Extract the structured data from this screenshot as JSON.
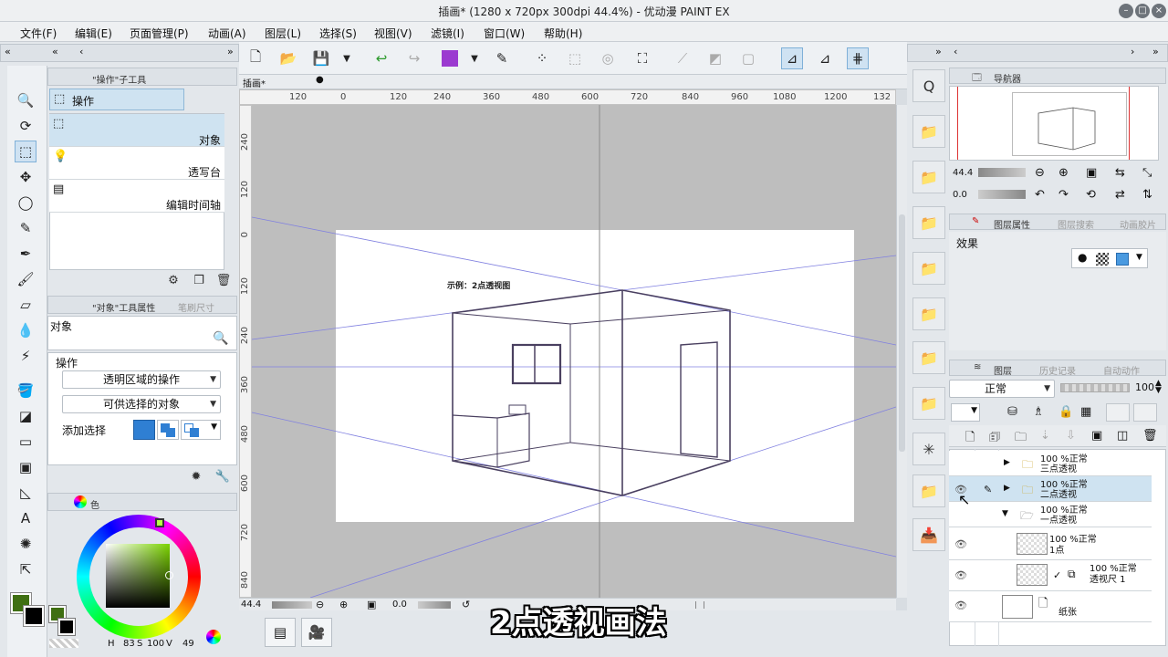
{
  "window": {
    "title": "插画* (1280 x 720px 300dpi 44.4%)  - 优动漫 PAINT EX",
    "minimize": "–",
    "restore": "□",
    "close": "×"
  },
  "menu": [
    "文件(F)",
    "编辑(E)",
    "页面管理(P)",
    "动画(A)",
    "图层(L)",
    "选择(S)",
    "视图(V)",
    "滤镜(I)",
    "窗口(W)",
    "帮助(H)"
  ],
  "tool_panel": {
    "tab": "\"操作\"子工具",
    "group_label": "操作",
    "subtools": [
      {
        "label": "对象",
        "icon": "object-select-icon"
      },
      {
        "label": "透写台",
        "icon": "light-table-icon"
      },
      {
        "label": "编辑时间轴",
        "icon": "timeline-icon"
      }
    ]
  },
  "property_panel": {
    "tab": "\"对象\"工具属性",
    "tab2": "笔刷尺寸",
    "title": "对象",
    "section": "操作",
    "dropdown1": "透明区域的操作",
    "dropdown2": "可供选择的对象",
    "add_select_label": "添加选择"
  },
  "color_panel": {
    "tab": "色",
    "h": "83",
    "s": "100",
    "v": "49",
    "h_label": "H",
    "s_label": "S",
    "v_label": "V"
  },
  "canvas": {
    "tab": "插画*",
    "ruler_h": [
      "120",
      "0",
      "120",
      "240",
      "360",
      "480",
      "600",
      "720",
      "840",
      "960",
      "1080",
      "1200",
      "132"
    ],
    "ruler_v": [
      "240",
      "120",
      "0",
      "120",
      "240",
      "360",
      "480",
      "600",
      "720",
      "840"
    ],
    "drawing_label": "示例：2点透视图",
    "zoom": "44.4",
    "rotate": "0.0"
  },
  "navigator": {
    "tab": "导航器",
    "zoom": "44.4",
    "rotate": "0.0"
  },
  "layer_property": {
    "tab": "图层属性",
    "tab2": "图层搜索",
    "tab3": "动画胶片",
    "effect_label": "效果"
  },
  "layer_panel": {
    "tab": "图层",
    "tab2": "历史记录",
    "tab3": "自动动作",
    "blend_mode": "正常",
    "opacity": "100",
    "layers": [
      {
        "line1": "100 %正常",
        "line2": "三点透视",
        "type": "folder"
      },
      {
        "line1": "100 %正常",
        "line2": "二点透视",
        "type": "folder"
      },
      {
        "line1": "100 %正常",
        "line2": "一点透视",
        "type": "folder-open"
      },
      {
        "line1": "100 %正常",
        "line2": "1点",
        "type": "raster"
      },
      {
        "line1": "100 %正常",
        "line2": "透视尺 1",
        "type": "ruler"
      },
      {
        "line1": "",
        "line2": "纸张",
        "type": "paper"
      }
    ]
  },
  "subtitle": "2点透视画法",
  "colors": {
    "main": "#3f6f12",
    "sub": "#000000",
    "accent_purple": "#9b3ad0",
    "selected": "#cfe3f1"
  }
}
